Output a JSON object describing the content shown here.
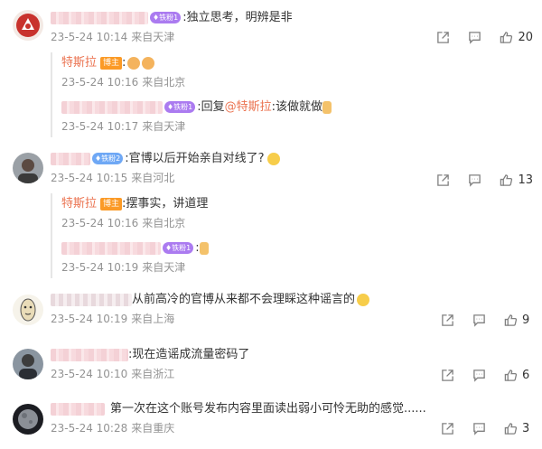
{
  "comments": [
    {
      "badge": "铁粉1",
      "text": ":独立思考，明辨是非",
      "time": "23-5-24 10:14",
      "location": "来自天津",
      "likes": "20",
      "replies": [
        {
          "author": "特斯拉",
          "author_badge": "博主",
          "text": ":",
          "time": "23-5-24 10:16",
          "location": "来自北京"
        },
        {
          "badge": "铁粉1",
          "text_prefix": ":回复",
          "mention": "@特斯拉",
          "text": ":该做就做",
          "time": "23-5-24 10:17",
          "location": "来自天津"
        }
      ]
    },
    {
      "badge": "铁粉2",
      "text": ":官博以后开始亲自对线了?",
      "time": "23-5-24 10:15",
      "location": "来自河北",
      "likes": "13",
      "replies": [
        {
          "author": "特斯拉",
          "author_badge": "博主",
          "text": ":摆事实，讲道理",
          "time": "23-5-24 10:16",
          "location": "来自北京"
        },
        {
          "badge": "铁粉1",
          "text": ":",
          "time": "23-5-24 10:19",
          "location": "来自天津"
        }
      ]
    },
    {
      "text": "从前高冷的官博从来都不会理睬这种谣言的",
      "time": "23-5-24 10:19",
      "location": "来自上海",
      "likes": "9"
    },
    {
      "text": ":现在造谣成流量密码了",
      "time": "23-5-24 10:10",
      "location": "来自浙江",
      "likes": "6"
    },
    {
      "text": "第一次在这个账号发布内容里面读出弱小可怜无助的感觉......",
      "time": "23-5-24 10:28",
      "location": "来自重庆",
      "likes": "3"
    }
  ],
  "icons": {
    "share": "share-icon",
    "comment": "comment-icon",
    "like": "like-icon"
  },
  "colors": {
    "mention": "#eb7350",
    "meta": "#939393",
    "badge_fan": "#ab7bf0",
    "badge_fan2": "#6fa8f5",
    "badge_blogger": "#fb9a26"
  }
}
